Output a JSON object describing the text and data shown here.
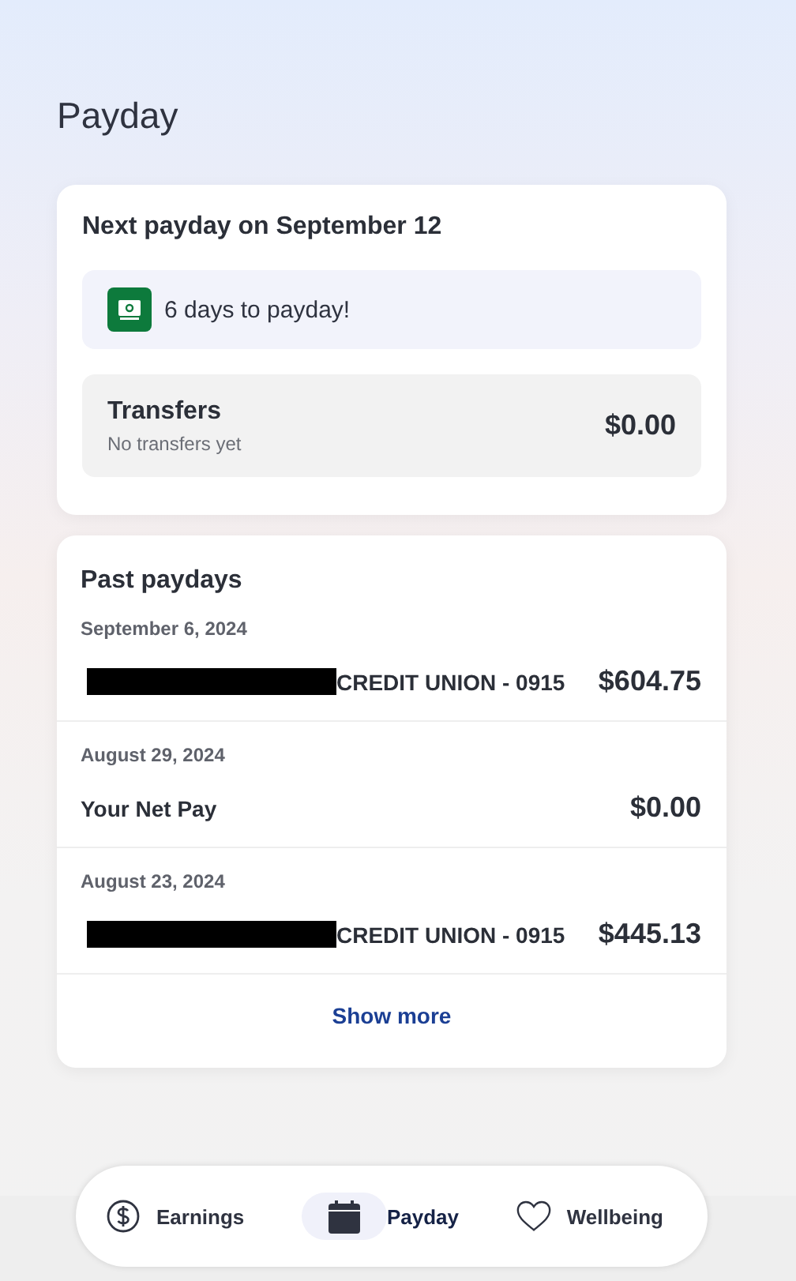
{
  "page_title": "Payday",
  "next_payday": {
    "title": "Next payday on September 12",
    "countdown": "6 days to payday!",
    "transfers": {
      "label": "Transfers",
      "note": "No transfers yet",
      "amount": "$0.00"
    }
  },
  "past_paydays": {
    "title": "Past paydays",
    "items": [
      {
        "date": "September 6, 2024",
        "description": "CREDIT UNION - 0915",
        "redacted": true,
        "amount": "$604.75"
      },
      {
        "date": "August 29, 2024",
        "description": "Your Net Pay",
        "redacted": false,
        "amount": "$0.00"
      },
      {
        "date": "August 23, 2024",
        "description": "CREDIT UNION - 0915",
        "redacted": true,
        "amount": "$445.13"
      }
    ],
    "show_more": "Show more"
  },
  "nav": [
    {
      "kind": "earnings",
      "label": "Earnings",
      "selected": false
    },
    {
      "kind": "payday",
      "label": "Payday",
      "selected": true
    },
    {
      "kind": "wellbeing",
      "label": "Wellbeing",
      "selected": false
    }
  ]
}
